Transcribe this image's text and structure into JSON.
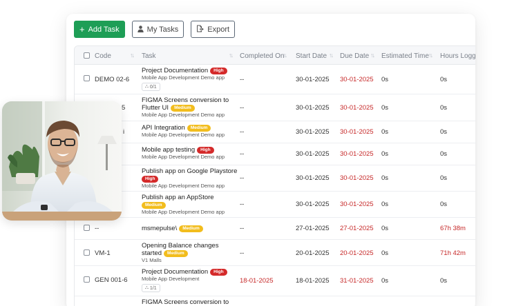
{
  "toolbar": {
    "add_task": "Add Task",
    "my_tasks": "My Tasks",
    "export": "Export"
  },
  "columns": {
    "code": "Code",
    "task": "Task",
    "completed_on": "Completed On",
    "start_date": "Start Date",
    "due_date": "Due Date",
    "estimated_time": "Estimated Time",
    "hours_logged": "Hours Logge"
  },
  "rows": [
    {
      "code": "DEMO 02-6",
      "title": "Project Documentation",
      "badge": "High",
      "project": "Mobile App Development Demo app",
      "subcount": "0/1",
      "completed": "--",
      "start": "30-01-2025",
      "due": "30-01-2025",
      "est": "0s",
      "logged": "0s"
    },
    {
      "code": "5",
      "title": "FIGMA Screens conversion to",
      "title2": "Flutter UI",
      "badge": "Medium",
      "project": "Mobile App Development Demo app",
      "completed": "--",
      "start": "30-01-2025",
      "due": "30-01-2025",
      "est": "0s",
      "logged": "0s"
    },
    {
      "code": "i",
      "title": "API Integration",
      "badge": "Medium",
      "project": "Mobile App Development Demo app",
      "completed": "--",
      "start": "30-01-2025",
      "due": "30-01-2025",
      "est": "0s",
      "logged": "0s"
    },
    {
      "code": "",
      "title": "Mobile app testing",
      "badge": "High",
      "project": "Mobile App Development Demo app",
      "completed": "--",
      "start": "30-01-2025",
      "due": "30-01-2025",
      "est": "0s",
      "logged": "0s"
    },
    {
      "code": "",
      "title": "Publish app on Google Playstore",
      "badge": "High",
      "project": "Mobile App Development Demo app",
      "completed": "--",
      "start": "30-01-2025",
      "due": "30-01-2025",
      "est": "0s",
      "logged": "0s"
    },
    {
      "code": "",
      "title": "Publish app an AppStore",
      "badge": "Medium",
      "project": "Mobile App Development Demo app",
      "completed": "--",
      "start": "30-01-2025",
      "due": "30-01-2025",
      "est": "0s",
      "logged": "0s"
    },
    {
      "code": "--",
      "title": "msmepulse\\",
      "badge": "Medium",
      "completed": "--",
      "start": "27-01-2025",
      "due": "27-01-2025",
      "est": "0s",
      "logged": "67h 38m"
    },
    {
      "code": "VM-1",
      "title": "Opening Balance changes",
      "title2": "started",
      "badge": "Medium",
      "project": "V1 Malls",
      "completed": "--",
      "start": "20-01-2025",
      "due": "20-01-2025",
      "est": "0s",
      "logged": "71h 42m"
    },
    {
      "code": "GEN 001-6",
      "title": "Project Documentation",
      "badge": "High",
      "project": "Mobile App Development",
      "subcount": "1/1",
      "completed": "18-01-2025",
      "start": "18-01-2025",
      "due": "31-01-2025",
      "est": "0s",
      "logged": "0s"
    },
    {
      "code": "",
      "title": "FIGMA Screens conversion to"
    }
  ],
  "colors": {
    "primary": "#1e9e56",
    "high": "#d42a2a",
    "medium": "#f2bd1d",
    "overdue": "#c62828"
  }
}
